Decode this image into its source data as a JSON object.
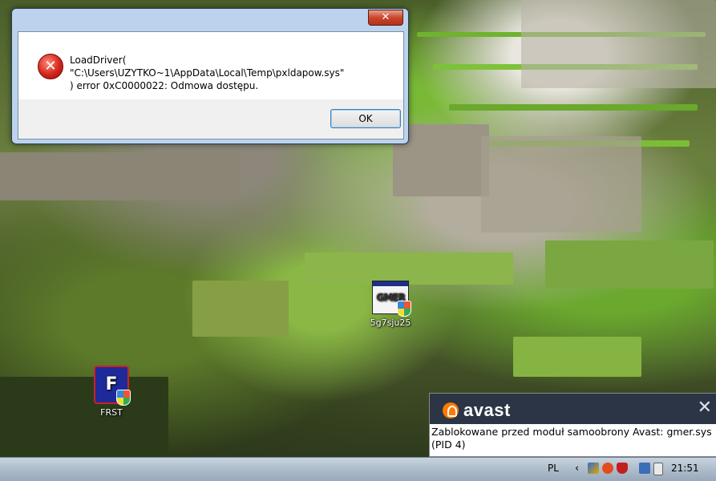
{
  "dialog": {
    "close_glyph": "✕",
    "message_line1": "LoadDriver( \"C:\\Users\\UZYTKO~1\\AppData\\Local\\Temp\\pxldapow.sys\"",
    "message_line2": ") error 0xC0000022: Odmowa dostępu.",
    "ok_label": "OK"
  },
  "desktop": {
    "icons": [
      {
        "label": "5g7sju25",
        "image_text": "GMER"
      },
      {
        "label": "FRST"
      }
    ]
  },
  "toast": {
    "brand": "avast",
    "close_glyph": "✕",
    "message": "Zablokowane przed moduł samoobrony Avast: gmer.sys (PID 4)"
  },
  "taskbar": {
    "language": "PL",
    "clock": "21:51"
  }
}
